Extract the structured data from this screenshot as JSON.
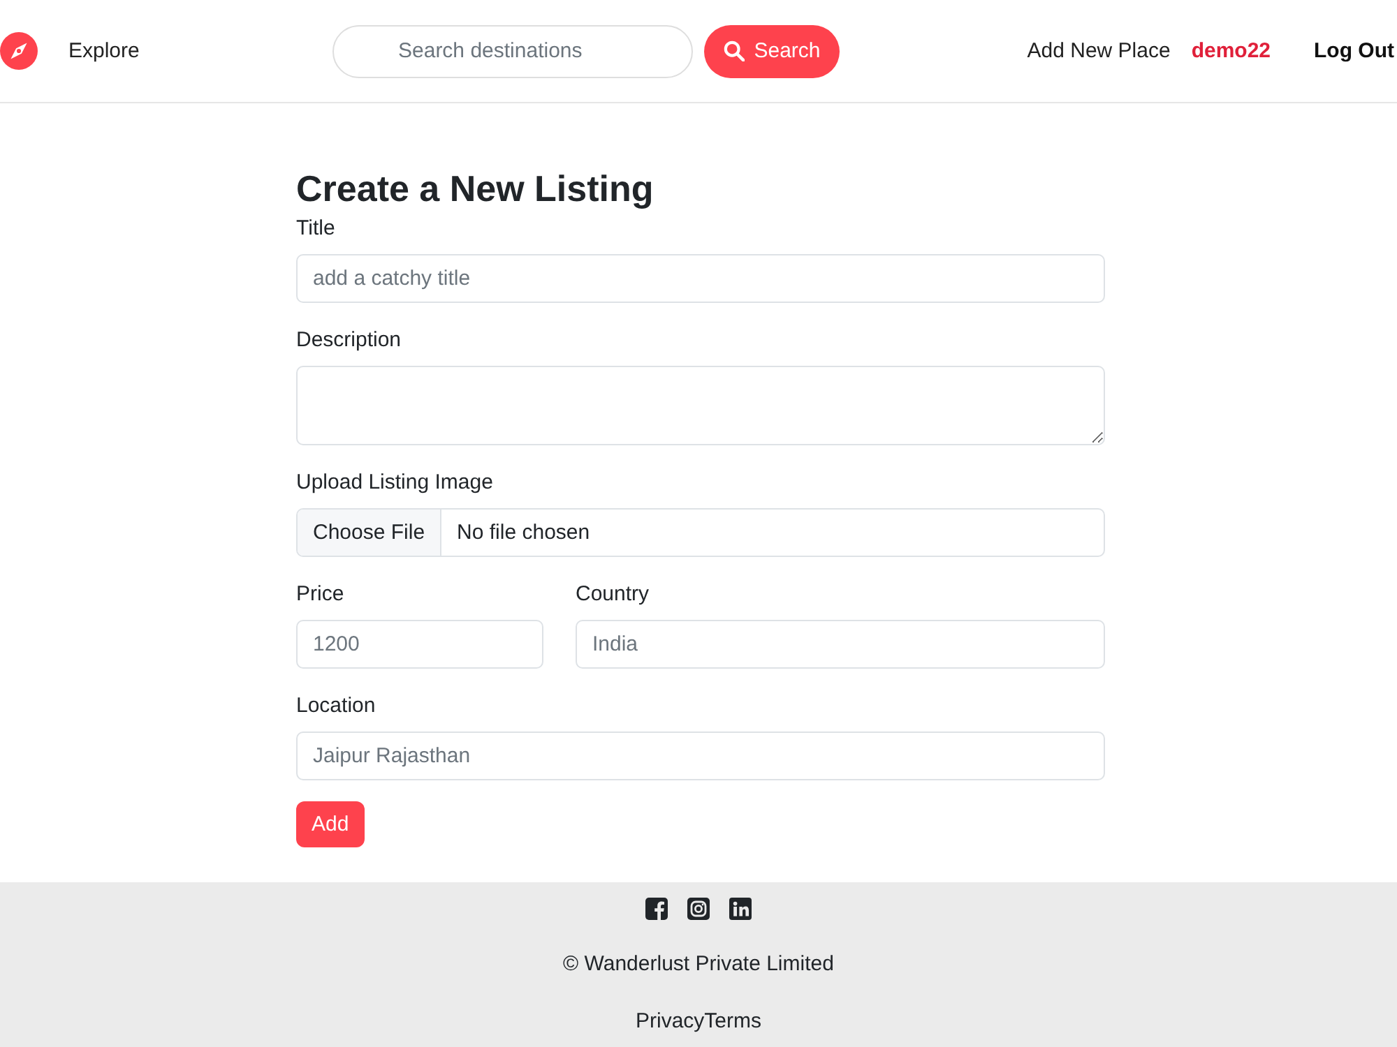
{
  "navbar": {
    "nav_links": [
      {
        "label": "Explore"
      }
    ],
    "search": {
      "placeholder": "Search destinations",
      "button": "Search"
    },
    "right_links": [
      {
        "label": "Add New Place",
        "kind": "link"
      },
      {
        "label": "demo22",
        "kind": "user"
      },
      {
        "label": "Log Out",
        "kind": "action"
      }
    ]
  },
  "form": {
    "heading": "Create a New Listing",
    "rows": [
      {
        "fields": [
          {
            "label": "Title",
            "kind": "text",
            "placeholder": "add a catchy title"
          }
        ]
      },
      {
        "fields": [
          {
            "label": "Description",
            "kind": "textarea"
          }
        ]
      },
      {
        "fields": [
          {
            "label": "Upload Listing Image",
            "kind": "file",
            "button": "Choose File",
            "status": "No file chosen"
          }
        ]
      },
      {
        "fields": [
          {
            "label": "Price",
            "kind": "text",
            "placeholder": "1200"
          },
          {
            "label": "Country",
            "kind": "text",
            "placeholder": "India"
          }
        ]
      },
      {
        "fields": [
          {
            "label": "Location",
            "kind": "text",
            "placeholder": "Jaipur Rajasthan"
          }
        ]
      }
    ],
    "submit": "Add"
  },
  "footer": {
    "copyright": "© Wanderlust Private Limited",
    "links": [
      "Privacy",
      "Terms"
    ]
  }
}
